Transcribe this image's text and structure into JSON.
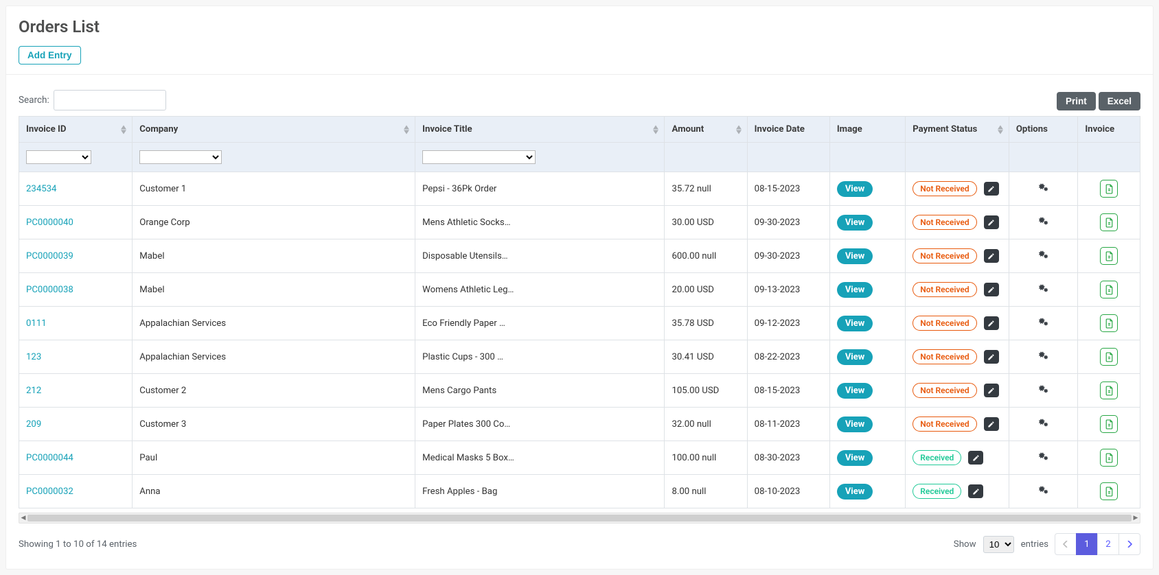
{
  "page": {
    "title": "Orders List",
    "add_entry": "Add Entry",
    "search_label": "Search:",
    "print": "Print",
    "excel": "Excel"
  },
  "columns": {
    "invoice_id": "Invoice ID",
    "company": "Company",
    "invoice_title": "Invoice Title",
    "amount": "Amount",
    "invoice_date": "Invoice Date",
    "image": "Image",
    "payment_status": "Payment Status",
    "options": "Options",
    "invoice": "Invoice"
  },
  "labels": {
    "view": "View",
    "not_received": "Not Received",
    "received": "Received"
  },
  "rows": [
    {
      "invoice_id": "234534",
      "company": "Customer 1",
      "title": "Pepsi - 36Pk Order",
      "amount": "35.72 null",
      "date": "08-15-2023",
      "status": "not_received"
    },
    {
      "invoice_id": "PC0000040",
      "company": "Orange Corp",
      "title": "Mens Athletic Socks…",
      "amount": "30.00 USD",
      "date": "09-30-2023",
      "status": "not_received"
    },
    {
      "invoice_id": "PC0000039",
      "company": "Mabel",
      "title": "Disposable Utensils…",
      "amount": "600.00 null",
      "date": "09-30-2023",
      "status": "not_received"
    },
    {
      "invoice_id": "PC0000038",
      "company": "Mabel",
      "title": "Womens Athletic Leg…",
      "amount": "20.00 USD",
      "date": "09-13-2023",
      "status": "not_received"
    },
    {
      "invoice_id": "0111",
      "company": "Appalachian Services",
      "title": "Eco Friendly Paper …",
      "amount": "35.78 USD",
      "date": "09-12-2023",
      "status": "not_received"
    },
    {
      "invoice_id": "123",
      "company": "Appalachian Services",
      "title": "Plastic Cups - 300 …",
      "amount": "30.41 USD",
      "date": "08-22-2023",
      "status": "not_received"
    },
    {
      "invoice_id": "212",
      "company": "Customer 2",
      "title": "Mens Cargo Pants",
      "amount": "105.00 USD",
      "date": "08-15-2023",
      "status": "not_received"
    },
    {
      "invoice_id": "209",
      "company": "Customer 3",
      "title": "Paper Plates 300 Co…",
      "amount": "32.00 null",
      "date": "08-11-2023",
      "status": "not_received"
    },
    {
      "invoice_id": "PC0000044",
      "company": "Paul",
      "title": "Medical Masks 5 Box…",
      "amount": "100.00 null",
      "date": "08-30-2023",
      "status": "received"
    },
    {
      "invoice_id": "PC0000032",
      "company": "Anna",
      "title": "Fresh Apples - Bag",
      "amount": "8.00 null",
      "date": "08-10-2023",
      "status": "received"
    }
  ],
  "footer": {
    "info": "Showing 1 to 10 of 14 entries",
    "show": "Show",
    "entries": "entries",
    "length_value": "10",
    "pages": [
      "1",
      "2"
    ],
    "active_page": "1"
  }
}
